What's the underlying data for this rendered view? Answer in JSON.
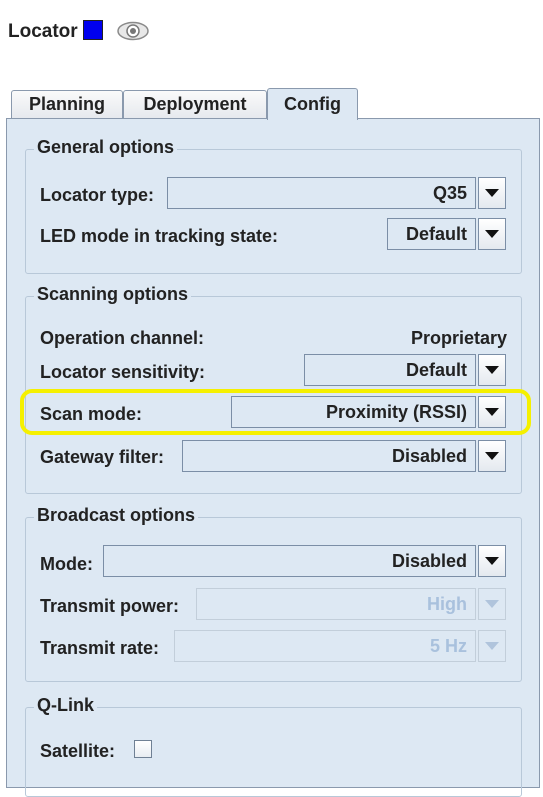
{
  "header": {
    "title": "Locator",
    "color_swatch": "#0000ee",
    "visibility_icon": "eye-icon"
  },
  "tabs": [
    {
      "label": "Planning",
      "active": false
    },
    {
      "label": "Deployment",
      "active": false
    },
    {
      "label": "Config",
      "active": true
    }
  ],
  "general_options": {
    "title": "General options",
    "locator_type_label": "Locator type:",
    "locator_type_value": "Q35",
    "led_mode_label": "LED mode in tracking state:",
    "led_mode_value": "Default"
  },
  "scanning_options": {
    "title": "Scanning options",
    "operation_channel_label": "Operation channel:",
    "operation_channel_value": "Proprietary",
    "sensitivity_label": "Locator sensitivity:",
    "sensitivity_value": "Default",
    "scan_mode_label": "Scan mode:",
    "scan_mode_value": "Proximity (RSSI)",
    "gateway_filter_label": "Gateway filter:",
    "gateway_filter_value": "Disabled"
  },
  "broadcast_options": {
    "title": "Broadcast options",
    "mode_label": "Mode:",
    "mode_value": "Disabled",
    "transmit_power_label": "Transmit power:",
    "transmit_power_value": "High",
    "transmit_rate_label": "Transmit rate:",
    "transmit_rate_value": "5 Hz"
  },
  "q_link": {
    "title": "Q-Link",
    "satellite_label": "Satellite:",
    "satellite_checked": false
  },
  "highlight_color": "#f5f000"
}
